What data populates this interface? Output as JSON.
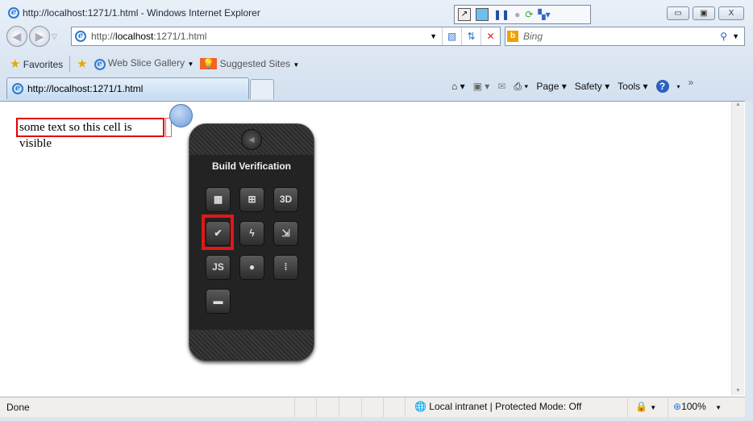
{
  "window": {
    "title": "http://localhost:1271/1.html - Windows Internet Explorer",
    "minimize": "▭",
    "restore": "▣",
    "close": "X"
  },
  "address": {
    "prefix": "http://",
    "host": "localhost",
    "suffix": ":1271/1.html"
  },
  "search": {
    "placeholder": "Bing"
  },
  "favorites": {
    "label": "Favorites",
    "items": [
      {
        "label": "Web Slice Gallery"
      },
      {
        "label": "Suggested Sites"
      }
    ]
  },
  "tab": {
    "label": "http://localhost:1271/1.html"
  },
  "toolbar": {
    "page": "Page",
    "safety": "Safety",
    "tools": "Tools"
  },
  "page": {
    "text": "some text so this cell is visible"
  },
  "widget": {
    "title": "Build Verification",
    "icons": [
      {
        "name": "layout-icon",
        "glyph": "▦"
      },
      {
        "name": "hierarchy-icon",
        "glyph": "⊞"
      },
      {
        "name": "3d-icon",
        "glyph": "3D"
      },
      {
        "name": "checklist-icon",
        "glyph": "✔"
      },
      {
        "name": "lightning-icon",
        "glyph": "ϟ"
      },
      {
        "name": "drag-icon",
        "glyph": "⇲"
      },
      {
        "name": "javascript-icon",
        "glyph": "JS"
      },
      {
        "name": "mouse-icon",
        "glyph": "●"
      },
      {
        "name": "resize-icon",
        "glyph": "⁞"
      },
      {
        "name": "image-icon",
        "glyph": "▬"
      }
    ],
    "selected": "checklist-icon"
  },
  "status": {
    "text": "Done",
    "zone": "Local intranet | Protected Mode: Off",
    "zoom": "100%"
  }
}
